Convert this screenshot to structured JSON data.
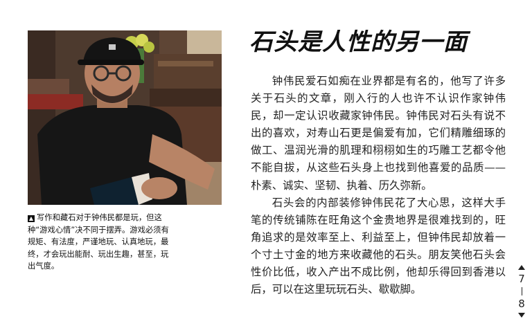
{
  "article": {
    "title": "石头是人性的另一面",
    "paragraphs": [
      "钟伟民爱石如痴在业界都是有名的，他写了许多关于石头的文章，刚入行的人也许不认识作家钟伟民，却一定认识收藏家钟伟民。钟伟民对石头有说不出的喜欢，对寿山石更是偏爱有加，它们精雕细琢的做工、温润光滑的肌理和栩栩如生的巧雕工艺都令他不能自拔，从这些石头身上也找到他喜爱的品质——朴素、诚实、坚韧、执着、历久弥新。",
      "石头会的内部装修钟伟民花了大心思，这样大手笔的传统铺陈在旺角这个金贵地界是很难找到的，旺角追求的是效率至上、利益至上，但钟伟民却放着一个寸土寸金的地方来收藏他的石头。朋友笑他石头会性价比低，收入产出不成比例，他却乐得回到香港以后，可以在这里玩玩石头、歇歇脚。"
    ]
  },
  "photo": {
    "icon": "portrait-photo"
  },
  "caption": {
    "icon": "up-arrow-icon",
    "text": "写作和藏石对于钟伟民都是玩，但这种“游戏心情”决不同于摆弄。游戏必须有规矩、有法度，严谨地玩、认真地玩，最终，才会玩出能耐、玩出生趣，甚至，玩出气度。"
  },
  "pager": {
    "prev_icon": "triangle-up-icon",
    "next_icon": "triangle-down-icon",
    "page_left": "7",
    "page_right": "8"
  },
  "colors": {
    "text": "#1a1a1a",
    "shirt": "#161616",
    "wall": "#5a4436"
  }
}
